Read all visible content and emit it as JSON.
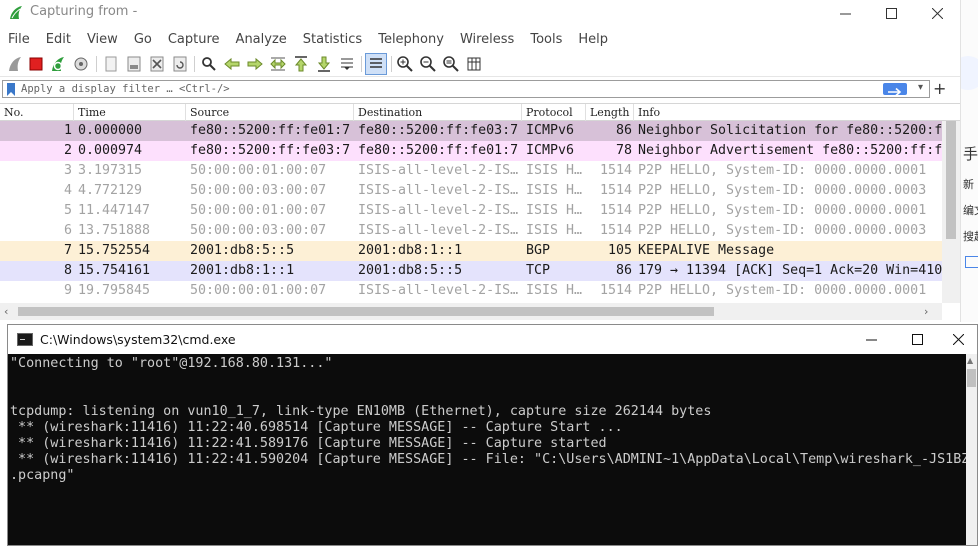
{
  "wireshark": {
    "title": "Capturing from -",
    "menu": [
      "File",
      "Edit",
      "View",
      "Go",
      "Capture",
      "Analyze",
      "Statistics",
      "Telephony",
      "Wireless",
      "Tools",
      "Help"
    ],
    "filter_placeholder": "Apply a display filter … <Ctrl-/>",
    "columns": [
      "No.",
      "Time",
      "Source",
      "Destination",
      "Protocol",
      "Length",
      "Info"
    ],
    "packets": [
      {
        "no": "1",
        "time": "0.000000",
        "src": "fe80::5200:ff:fe01:7",
        "dst": "fe80::5200:ff:fe03:7",
        "proto": "ICMPv6",
        "len": "86",
        "info": "Neighbor Solicitation for fe80::5200:ff:f",
        "bg": "#d7c1d8",
        "fg": "#1b1b1b"
      },
      {
        "no": "2",
        "time": "0.000974",
        "src": "fe80::5200:ff:fe03:7",
        "dst": "fe80::5200:ff:fe01:7",
        "proto": "ICMPv6",
        "len": "78",
        "info": "Neighbor Advertisement fe80::5200:ff:fe",
        "bg": "#fde0fd",
        "fg": "#1b1b1b"
      },
      {
        "no": "3",
        "time": "3.197315",
        "src": "50:00:00:01:00:07",
        "dst": "ISIS-all-level-2-IS…",
        "proto": "ISIS H…",
        "len": "1514",
        "info": "P2P HELLO, System-ID: 0000.0000.0001",
        "bg": "#ffffff",
        "fg": "#a3a3a3"
      },
      {
        "no": "4",
        "time": "4.772129",
        "src": "50:00:00:03:00:07",
        "dst": "ISIS-all-level-2-IS…",
        "proto": "ISIS H…",
        "len": "1514",
        "info": "P2P HELLO, System-ID: 0000.0000.0003",
        "bg": "#ffffff",
        "fg": "#a3a3a3"
      },
      {
        "no": "5",
        "time": "11.447147",
        "src": "50:00:00:01:00:07",
        "dst": "ISIS-all-level-2-IS…",
        "proto": "ISIS H…",
        "len": "1514",
        "info": "P2P HELLO, System-ID: 0000.0000.0001",
        "bg": "#ffffff",
        "fg": "#a3a3a3"
      },
      {
        "no": "6",
        "time": "13.751888",
        "src": "50:00:00:03:00:07",
        "dst": "ISIS-all-level-2-IS…",
        "proto": "ISIS H…",
        "len": "1514",
        "info": "P2P HELLO, System-ID: 0000.0000.0003",
        "bg": "#ffffff",
        "fg": "#a3a3a3"
      },
      {
        "no": "7",
        "time": "15.752554",
        "src": "2001:db8:5::5",
        "dst": "2001:db8:1::1",
        "proto": "BGP",
        "len": "105",
        "info": "KEEPALIVE Message",
        "bg": "#fdf0d6",
        "fg": "#1b1b1b"
      },
      {
        "no": "8",
        "time": "15.754161",
        "src": "2001:db8:1::1",
        "dst": "2001:db8:5::5",
        "proto": "TCP",
        "len": "86",
        "info": "179 → 11394 [ACK] Seq=1 Ack=20 Win=410",
        "bg": "#e4e3fc",
        "fg": "#1b1b1b"
      },
      {
        "no": "9",
        "time": "19.795845",
        "src": "50:00:00:01:00:07",
        "dst": "ISIS-all-level-2-IS…",
        "proto": "ISIS H…",
        "len": "1514",
        "info": "P2P HELLO, System-ID: 0000.0000.0001",
        "bg": "#ffffff",
        "fg": "#a3a3a3"
      }
    ],
    "side_text": [
      "手",
      "新",
      "编文",
      "搜超"
    ]
  },
  "cmd": {
    "title": "C:\\Windows\\system32\\cmd.exe",
    "lines": [
      "\"Connecting to \"root\"@192.168.80.131...\"",
      "",
      "",
      "tcpdump: listening on vun10_1_7, link-type EN10MB (Ethernet), capture size 262144 bytes",
      " ** (wireshark:11416) 11:22:40.698514 [Capture MESSAGE] -- Capture Start ...",
      " ** (wireshark:11416) 11:22:41.589176 [Capture MESSAGE] -- Capture started",
      " ** (wireshark:11416) 11:22:41.590204 [Capture MESSAGE] -- File: \"C:\\Users\\ADMINI~1\\AppData\\Local\\Temp\\wireshark_-JS1BZ2",
      ".pcapng\""
    ]
  },
  "colors": {
    "accent": "#4a86e8",
    "cmd_bg": "#0c0c0c",
    "cmd_fg": "#cccccc"
  }
}
